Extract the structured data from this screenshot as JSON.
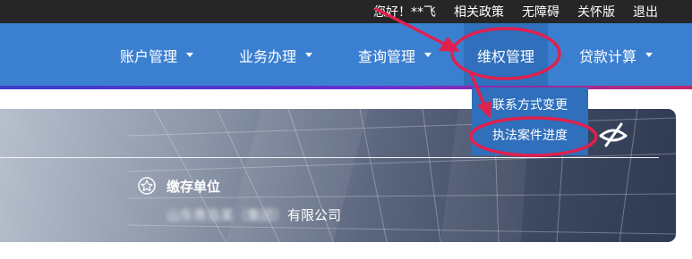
{
  "topbar": {
    "greeting": "您好！**飞",
    "links": [
      "相关政策",
      "无障碍",
      "关怀版",
      "退出"
    ]
  },
  "nav": {
    "items": [
      {
        "label": "账户管理"
      },
      {
        "label": "业务办理"
      },
      {
        "label": "查询管理"
      },
      {
        "label": "维权管理"
      },
      {
        "label": "贷款计算"
      }
    ],
    "dropdown": [
      "联系方式变更",
      "执法案件进度"
    ]
  },
  "banner": {
    "section_title": "缴存单位",
    "company_blurred": "山东青岛某（集团）",
    "company_suffix": "有限公司"
  },
  "colors": {
    "nav_bg": "#3b7fd1",
    "dropdown_bg": "#2f6fbc",
    "annotation": "#e0204e"
  },
  "icons": [
    "star-icon",
    "eye-off-icon",
    "caret-down-icon"
  ]
}
